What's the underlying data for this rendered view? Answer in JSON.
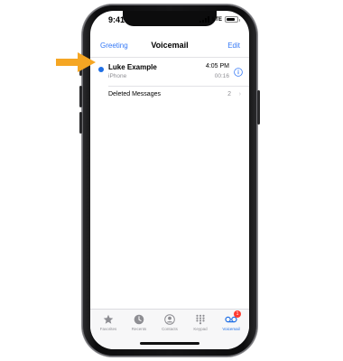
{
  "status_bar": {
    "time": "9:41",
    "carrier": "LTE",
    "battery_level": 0.85
  },
  "nav": {
    "left": "Greeting",
    "title": "Voicemail",
    "right": "Edit"
  },
  "voicemail": {
    "caller": "Luke Example",
    "label": "iPhone",
    "time": "4:05 PM",
    "duration": "00:16",
    "unread": true
  },
  "deleted": {
    "label": "Deleted Messages",
    "count": "2"
  },
  "tabs": [
    {
      "label": "Favorites",
      "icon": "star-icon"
    },
    {
      "label": "Recents",
      "icon": "clock-icon"
    },
    {
      "label": "Contacts",
      "icon": "person-icon"
    },
    {
      "label": "Keypad",
      "icon": "keypad-icon"
    },
    {
      "label": "Voicemail",
      "icon": "voicemail-icon",
      "active": true,
      "badge": "1"
    }
  ],
  "colors": {
    "accent": "#3478f6",
    "unread": "#1f6fe5",
    "badge": "#ff3b30",
    "arrow": "#f5a623"
  }
}
